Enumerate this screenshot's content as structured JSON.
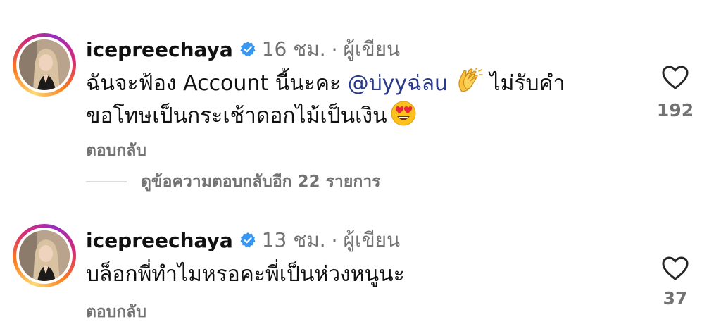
{
  "comments": [
    {
      "username": "icepreechaya",
      "time": "16 ชม.",
      "separator": "·",
      "role": "ผู้เขียน",
      "text_part1": "ฉันจะฟ้อง Account นี้นะคะ ",
      "mention": "@บ่yyฉ่ลu",
      "text_part2": " ไม่รับคำ",
      "text_part3": "ขอโทษเป็นกระเช้าดอกไม้เป็นเงิน",
      "reply_label": "ตอบกลับ",
      "view_replies": "ดูข้อความตอบกลับอีก 22 รายการ",
      "likes": "192",
      "icons": [
        "verified-badge-icon",
        "clapping-hands-emoji",
        "heart-eyes-emoji",
        "heart-outline-icon"
      ]
    },
    {
      "username": "icepreechaya",
      "time": "13 ชม.",
      "separator": "·",
      "role": "ผู้เขียน",
      "text": "บล็อกพี่ทำไมหรอคะพี่เป็นห่วงหนูนะ",
      "reply_label": "ตอบกลับ",
      "likes": "37",
      "icons": [
        "verified-badge-icon",
        "heart-outline-icon"
      ]
    }
  ],
  "colors": {
    "verified": "#3897f0",
    "meta": "#737373",
    "mention": "#2a3a8c",
    "text": "#111111"
  }
}
